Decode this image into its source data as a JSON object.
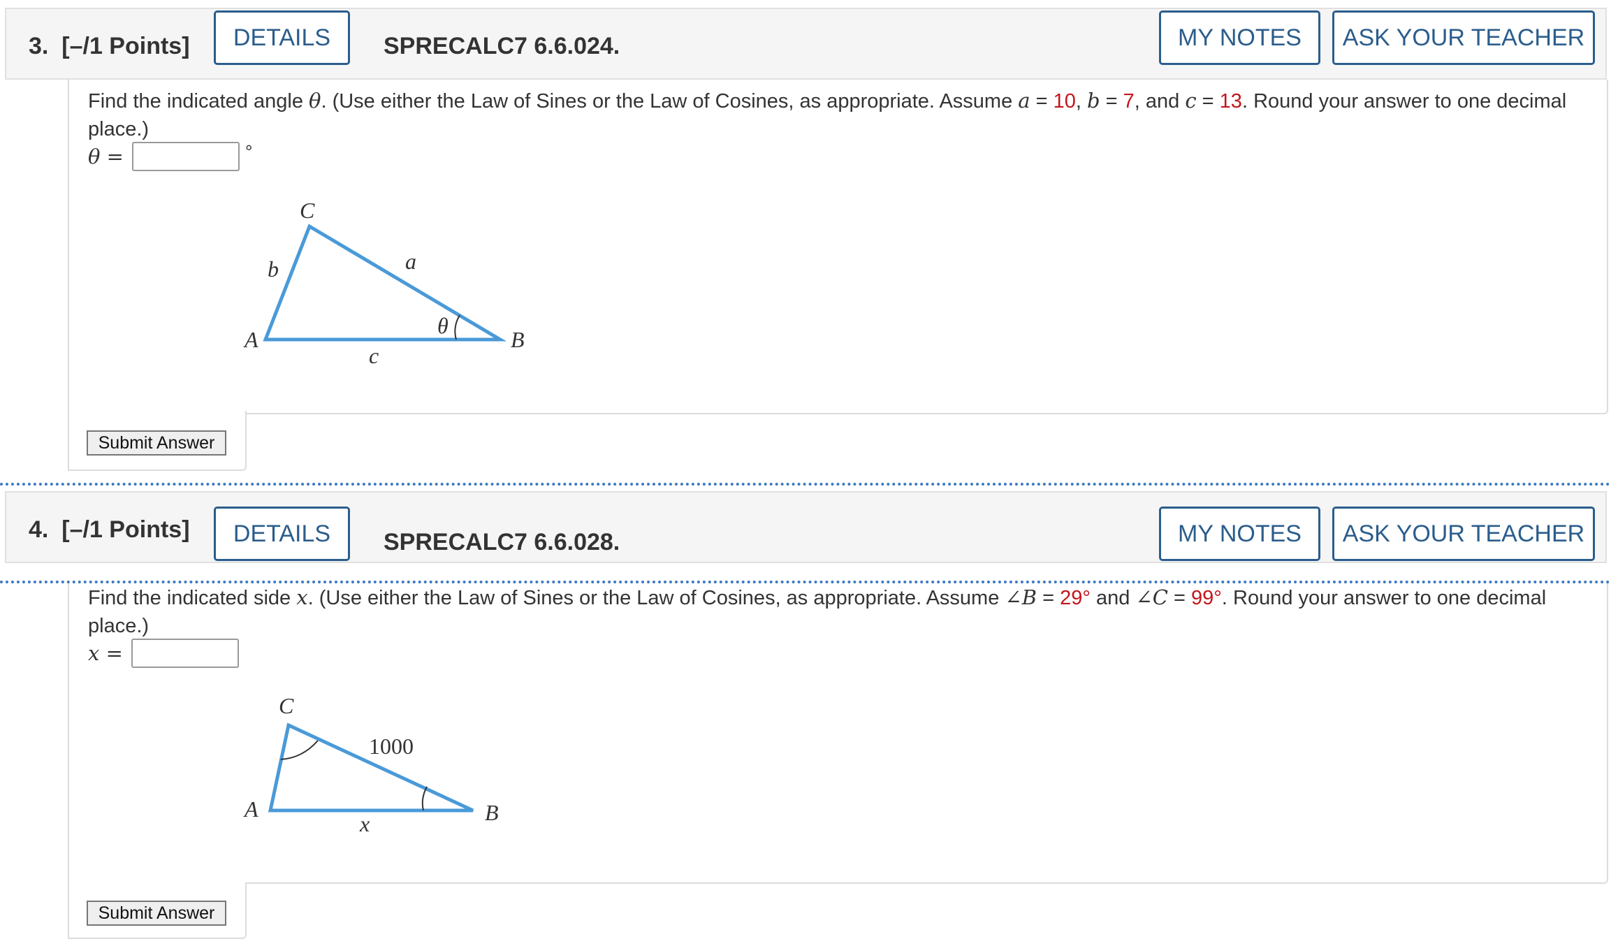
{
  "questions": [
    {
      "number": "3.",
      "points": "[–/1 Points]",
      "details_label": "DETAILS",
      "problem_code": "SPRECALC7 6.6.024.",
      "my_notes_label": "MY NOTES",
      "ask_teacher_label": "ASK YOUR TEACHER",
      "text_prefix": "Find the indicated angle ",
      "text_var": "θ",
      "text_mid": ". (Use either the Law of Sines or the Law of Cosines, as appropriate. Assume ",
      "given": [
        {
          "var": "a",
          "eq": " = ",
          "value": "10",
          "sep": ", "
        },
        {
          "var": "b",
          "eq": " = ",
          "value": "7",
          "sep": ", and "
        },
        {
          "var": "c",
          "eq": " = ",
          "value": "13",
          "sep": ". "
        }
      ],
      "text_suffix": "Round your answer to one decimal place.)",
      "answer_label": "θ =",
      "answer_unit": "°",
      "figure_labels": {
        "C": "C",
        "A": "A",
        "B": "B",
        "a": "a",
        "b": "b",
        "c": "c",
        "theta": "θ"
      },
      "submit_label": "Submit Answer"
    },
    {
      "number": "4.",
      "points": "[–/1 Points]",
      "details_label": "DETAILS",
      "problem_code": "SPRECALC7 6.6.028.",
      "my_notes_label": "MY NOTES",
      "ask_teacher_label": "ASK YOUR TEACHER",
      "text_prefix": "Find the indicated side ",
      "text_var": "x",
      "text_mid": ". (Use either the Law of Sines or the Law of Cosines, as appropriate. Assume ",
      "given": [
        {
          "var": "∠B",
          "eq": " = ",
          "value": "29°",
          "sep": " and "
        },
        {
          "var": "∠C",
          "eq": " = ",
          "value": "99°",
          "sep": ". "
        }
      ],
      "text_suffix": "Round your answer to one decimal place.)",
      "answer_label": "x =",
      "figure_labels": {
        "C": "C",
        "A": "A",
        "B": "B",
        "side": "1000",
        "x": "x"
      },
      "submit_label": "Submit Answer"
    }
  ],
  "colors": {
    "accent": "#2b5d8c",
    "value_red": "#c4161c",
    "triangle_blue": "#4a9ad8",
    "separator_dots": "#3b78c4"
  }
}
